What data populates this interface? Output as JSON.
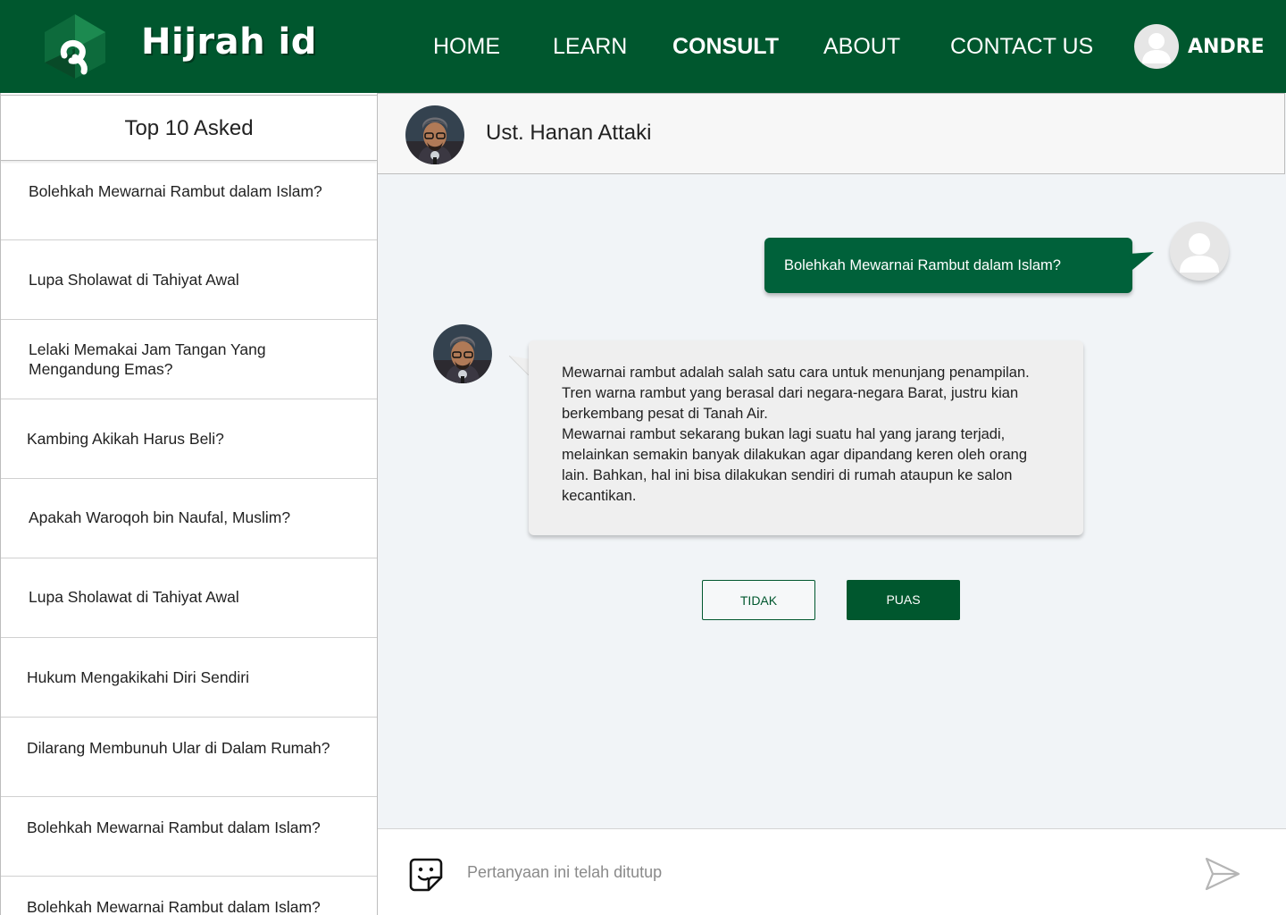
{
  "app": {
    "brand": "Hijrah id",
    "logo_icon": "hijrah-logo-icon"
  },
  "nav": {
    "items": [
      {
        "label": "HOME",
        "active": false
      },
      {
        "label": "LEARN",
        "active": false
      },
      {
        "label": "CONSULT",
        "active": true
      },
      {
        "label": "ABOUT",
        "active": false
      },
      {
        "label": "CONTACT US",
        "active": false
      }
    ],
    "user_name": "ANDRE"
  },
  "sidebar": {
    "title": "Top 10 Asked",
    "items": [
      {
        "label": "Bolehkah Mewarnai Rambut dalam Islam?"
      },
      {
        "label": "Lupa Sholawat di Tahiyat Awal"
      },
      {
        "label": "Lelaki Memakai Jam Tangan Yang Mengandung Emas?"
      },
      {
        "label": "Kambing Akikah Harus Beli?"
      },
      {
        "label": "Apakah Waroqoh bin Naufal, Muslim?"
      },
      {
        "label": "Lupa Sholawat di Tahiyat Awal"
      },
      {
        "label": "Hukum Mengakikahi Diri Sendiri"
      },
      {
        "label": "Dilarang Membunuh Ular di Dalam Rumah?"
      },
      {
        "label": "Bolehkah Mewarnai Rambut dalam Islam?"
      },
      {
        "label": "Bolehkah Mewarnai Rambut dalam Islam?"
      }
    ]
  },
  "chat": {
    "consultant_name": "Ust. Hanan Attaki",
    "user_message": "Bolehkah Mewarnai Rambut dalam Islam?",
    "reply_paragraphs": [
      "Mewarnai rambut adalah salah satu cara untuk menunjang penampilan. Tren warna rambut yang berasal dari negara-negara Barat, justru kian berkembang pesat di Tanah Air.",
      "Mewarnai rambut sekarang bukan lagi suatu hal yang jarang terjadi, melainkan semakin banyak dilakukan agar dipandang keren oleh orang lain. Bahkan, hal ini bisa dilakukan sendiri di rumah ataupun ke salon kecantikan."
    ],
    "btn_no": "TIDAK",
    "btn_yes": "PUAS"
  },
  "input": {
    "placeholder": "Pertanyaan ini telah ditutup",
    "value": ""
  },
  "colors": {
    "primary": "#00572e",
    "bubble": "#00613a",
    "background": "#f1f4f7"
  }
}
